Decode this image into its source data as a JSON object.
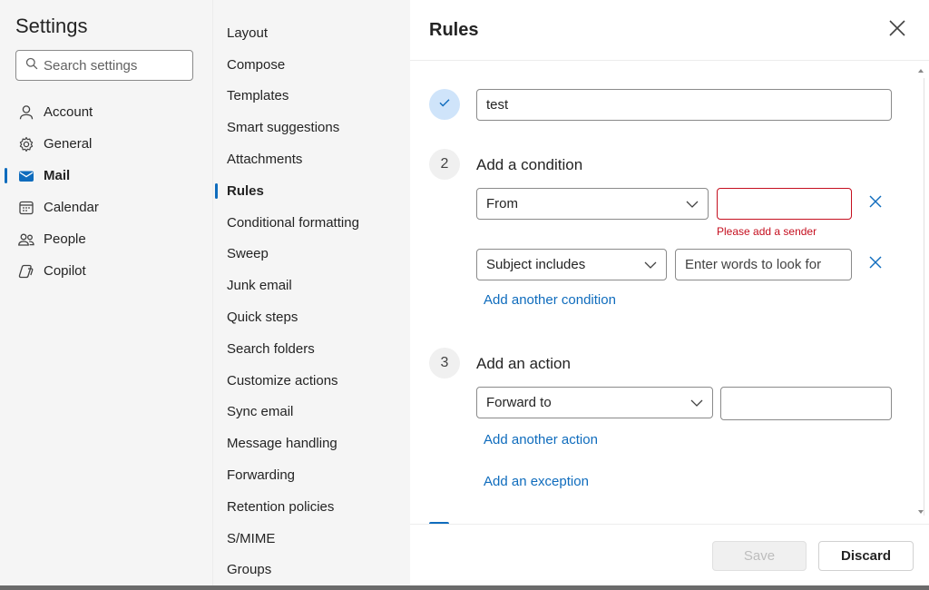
{
  "settings": {
    "title": "Settings",
    "search_placeholder": "Search settings",
    "nav": [
      {
        "label": "Account",
        "icon": "person-icon"
      },
      {
        "label": "General",
        "icon": "gear-icon"
      },
      {
        "label": "Mail",
        "icon": "mail-icon",
        "active": true
      },
      {
        "label": "Calendar",
        "icon": "calendar-icon"
      },
      {
        "label": "People",
        "icon": "people-icon"
      },
      {
        "label": "Copilot",
        "icon": "copilot-icon"
      }
    ]
  },
  "mail_menu": [
    "Layout",
    "Compose",
    "Templates",
    "Smart suggestions",
    "Attachments",
    "Rules",
    "Conditional formatting",
    "Sweep",
    "Junk email",
    "Quick steps",
    "Search folders",
    "Customize actions",
    "Sync email",
    "Message handling",
    "Forwarding",
    "Retention policies",
    "S/MIME",
    "Groups"
  ],
  "mail_menu_active": "Rules",
  "rules": {
    "title": "Rules",
    "rule_name_value": "test",
    "step2": {
      "number": "2",
      "title": "Add a condition",
      "condition1_select": "From",
      "condition1_error": "Please add a sender",
      "condition2_select": "Subject includes",
      "condition2_placeholder": "Enter words to look for",
      "add_condition_link": "Add another condition"
    },
    "step3": {
      "number": "3",
      "title": "Add an action",
      "action_select": "Forward to",
      "add_action_link": "Add another action",
      "add_exception_link": "Add an exception"
    },
    "save_label": "Save",
    "discard_label": "Discard"
  },
  "colors": {
    "accent": "#0f6cbd",
    "error": "#c50f1f",
    "step_done_bg": "#cfe4fa"
  }
}
